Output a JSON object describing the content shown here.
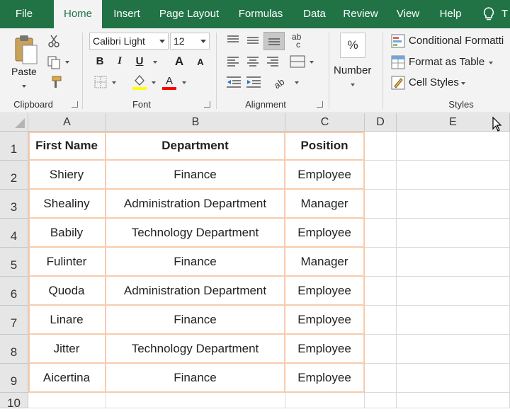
{
  "tabs": [
    {
      "label": "File",
      "active": false
    },
    {
      "label": "Home",
      "active": true
    },
    {
      "label": "Insert",
      "active": false
    },
    {
      "label": "Page Layout",
      "active": false
    },
    {
      "label": "Formulas",
      "active": false
    },
    {
      "label": "Data",
      "active": false
    },
    {
      "label": "Review",
      "active": false
    },
    {
      "label": "View",
      "active": false
    },
    {
      "label": "Help",
      "active": false
    }
  ],
  "tell_me_text": "T",
  "ribbon": {
    "clipboard": {
      "paste_label": "Paste",
      "group_label": "Clipboard"
    },
    "font": {
      "font_name": "Calibri Light",
      "font_size": "12",
      "bold": "B",
      "italic": "I",
      "underline": "U",
      "grow": "A",
      "shrink": "A",
      "group_label": "Font"
    },
    "alignment": {
      "group_label": "Alignment"
    },
    "number": {
      "format_symbol": "%",
      "label": "Number"
    },
    "styles": {
      "conditional_formatting": "Conditional Formatti",
      "format_as_table": "Format as Table",
      "cell_styles": "Cell Styles",
      "group_label": "Styles"
    }
  },
  "colors": {
    "ribbon_green": "#217346",
    "table_border": "#f8cbad",
    "fill_color_swatch": "#ffff00",
    "font_color_swatch": "#ff0000"
  },
  "columns": [
    "A",
    "B",
    "C",
    "D",
    "E"
  ],
  "rows": [
    "1",
    "2",
    "3",
    "4",
    "5",
    "6",
    "7",
    "8",
    "9",
    "10"
  ],
  "table": {
    "headers": [
      "First Name",
      "Department",
      "Position"
    ],
    "rows": [
      [
        "Shiery",
        "Finance",
        "Employee"
      ],
      [
        "Shealiny",
        "Administration Department",
        "Manager"
      ],
      [
        "Babily",
        "Technology Department",
        "Employee"
      ],
      [
        "Fulinter",
        "Finance",
        "Manager"
      ],
      [
        "Quoda",
        "Administration Department",
        "Employee"
      ],
      [
        "Linare",
        "Finance",
        "Employee"
      ],
      [
        "Jitter",
        "Technology Department",
        "Employee"
      ],
      [
        "Aicertina",
        "Finance",
        "Employee"
      ]
    ]
  }
}
